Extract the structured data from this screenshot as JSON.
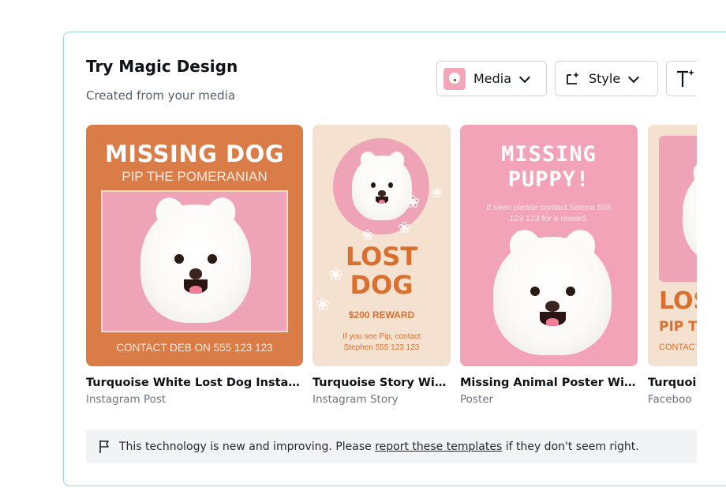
{
  "panel": {
    "title": "Try Magic Design",
    "subtitle": "Created from your media"
  },
  "toolbar": {
    "media_label": "Media",
    "style_label": "Style"
  },
  "cards": [
    {
      "title": "Turquoise White Lost Dog Instagram",
      "type": "Instagram Post",
      "art": {
        "headline": "MISSING DOG",
        "subhead": "PIP THE POMERANIAN",
        "footer": "CONTACT DEB ON 555 123 123"
      }
    },
    {
      "title": "Turquoise Story With...",
      "type": "Instagram Story",
      "art": {
        "headline1": "LOST",
        "headline2": "DOG",
        "reward": "$200 REWARD",
        "contact": "If you see Pip, contact Stephen 555 123 123"
      }
    },
    {
      "title": "Missing Animal Poster With...",
      "type": "Poster",
      "art": {
        "headline1": "MISSING",
        "headline2": "PUPPY!",
        "contact": "If seen please contact Selena 555 123 123 for a reward."
      }
    },
    {
      "title": "Turquois",
      "type": "Faceboo",
      "art": {
        "headline": "LOST",
        "subhead": "PIP THI",
        "contact": "CONTACT I"
      }
    }
  ],
  "notice": {
    "before": "This technology is new and improving. Please ",
    "link": "report these templates",
    "after": " if they don't seem right."
  },
  "colors": {
    "orange": "#d97c47",
    "pink": "#f2a3b8",
    "cream": "#f4e1cf",
    "panel_border": "#9bd3df"
  }
}
